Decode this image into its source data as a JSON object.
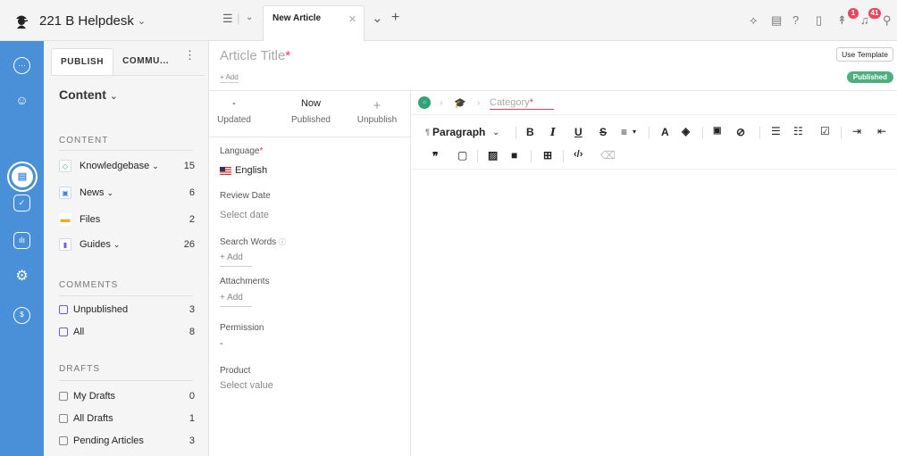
{
  "topbar": {
    "workspace_name": "221 B Helpdesk",
    "active_tab": "New Article",
    "notif_1": "1",
    "notif_2": "41",
    "icons": [
      "list-icon",
      "chevron-down-icon",
      "close-icon",
      "add-tab-icon",
      "sparkle-icon",
      "document-icon",
      "help-icon",
      "bookmark-icon",
      "rocket-icon",
      "bell-icon",
      "search-icon"
    ]
  },
  "rail": {
    "icons": [
      "chat-icon",
      "contacts-icon",
      "knowledgebase-icon",
      "tasks-icon",
      "reports-icon",
      "settings-icon",
      "billing-icon"
    ]
  },
  "sidebar": {
    "tab_publish": "PUBLISH",
    "tab_community": "COMMU...",
    "menu": "⋮",
    "title": "Content",
    "content_heading": "CONTENT",
    "content_items": [
      {
        "label": "Knowledgebase",
        "count": "15",
        "color": "#2fa37a"
      },
      {
        "label": "News",
        "count": "6",
        "color": "#4a7fd9"
      },
      {
        "label": "Files",
        "count": "2",
        "color": "#f0a92e"
      },
      {
        "label": "Guides",
        "count": "26",
        "color": "#7b5cd6"
      }
    ],
    "comments_heading": "COMMENTS",
    "comment_items": [
      {
        "label": "Unpublished",
        "count": "3"
      },
      {
        "label": "All",
        "count": "8"
      }
    ],
    "drafts_heading": "DRAFTS",
    "draft_items": [
      {
        "label": "My Drafts",
        "count": "0"
      },
      {
        "label": "All Drafts",
        "count": "1"
      },
      {
        "label": "Pending Articles",
        "count": "3"
      }
    ]
  },
  "article": {
    "title_placeholder": "Article Title",
    "required_mark": "*",
    "add_label": "+ Add",
    "use_template": "Use Template",
    "status_badge": "Published",
    "status_color": "#4caf7d"
  },
  "meta": {
    "updated_value": "-",
    "updated_label": "Updated",
    "published_value": "Now",
    "published_label": "Published",
    "unpublish_icon": "+",
    "unpublish_label": "Unpublish",
    "language_label": "Language",
    "language_value": "English",
    "review_label": "Review Date",
    "review_value": "Select date",
    "search_words_label": "Search Words",
    "search_words_add": "+ Add",
    "attachments_label": "Attachments",
    "attachments_add": "+ Add",
    "permission_label": "Permission",
    "permission_value": "-",
    "product_label": "Product",
    "product_value": "Select value"
  },
  "editor": {
    "category_placeholder": "Category",
    "paragraph_label": "Paragraph"
  }
}
